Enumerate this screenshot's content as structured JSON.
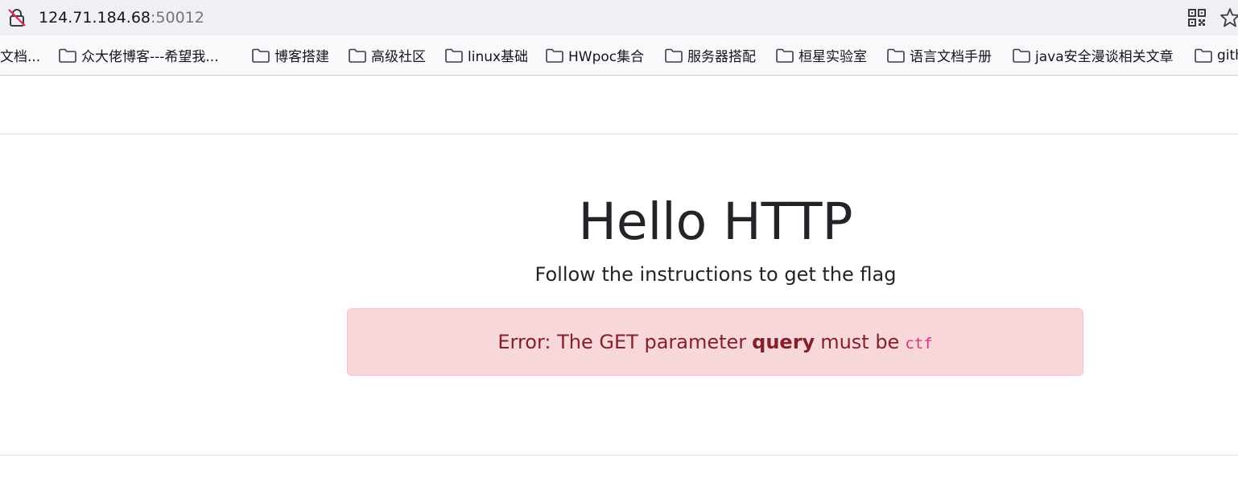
{
  "browser": {
    "url_host": "124.71.184.68",
    "url_port": ":50012",
    "bookmarks": [
      {
        "label": "文档..."
      },
      {
        "label": "众大佬博客---希望我..."
      },
      {
        "label": "博客搭建"
      },
      {
        "label": "高级社区"
      },
      {
        "label": "linux基础"
      },
      {
        "label": "HWpoc集合"
      },
      {
        "label": "服务器搭配"
      },
      {
        "label": "桓星实验室"
      },
      {
        "label": "语言文档手册"
      },
      {
        "label": "java安全漫谈相关文章"
      },
      {
        "label": "gith"
      }
    ]
  },
  "page": {
    "title": "Hello HTTP",
    "subtitle": "Follow the instructions to get the flag",
    "alert": {
      "prefix": "Error: The GET parameter",
      "param": "query",
      "middle": "must be",
      "value": "ctf"
    }
  },
  "colors": {
    "alert_bg": "#f8d7da",
    "alert_text": "#842029",
    "code_text": "#d63384"
  }
}
